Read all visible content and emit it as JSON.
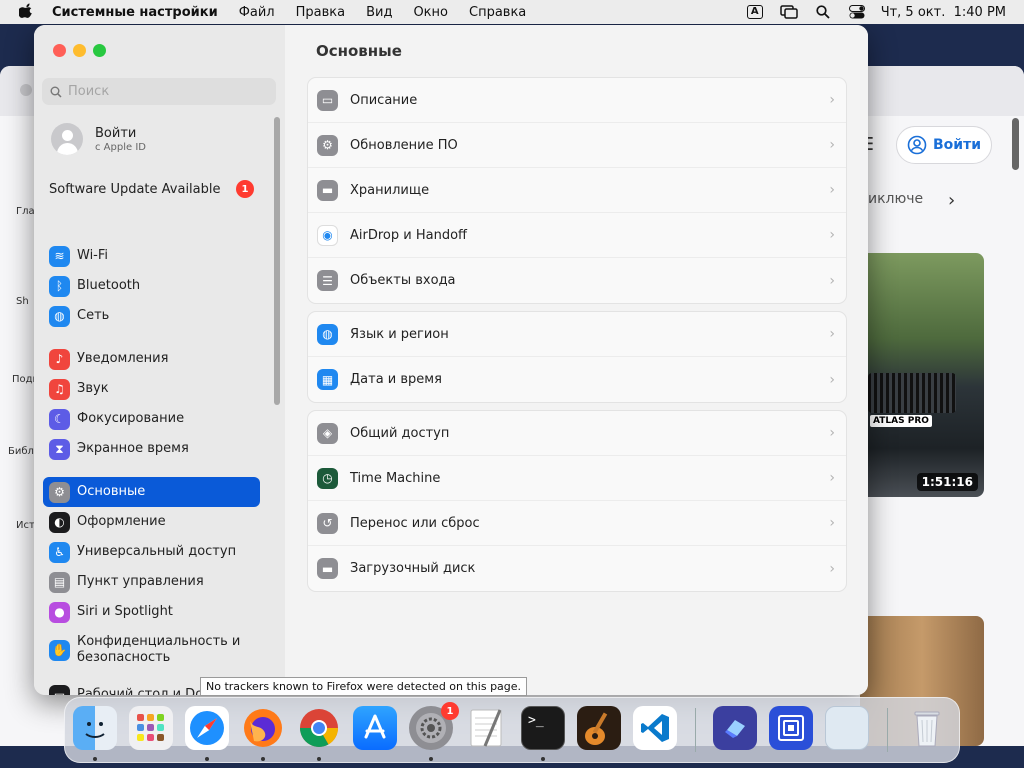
{
  "menubar": {
    "app_name": "Системные настройки",
    "items": [
      "Файл",
      "Правка",
      "Вид",
      "Окно",
      "Справка"
    ],
    "input_indicator": "A",
    "clock": "Чт, 5 окт.  1:40 PM"
  },
  "background_browser": {
    "login_label": "Войти",
    "chip_label": "иключе",
    "video_duration": "1:51:16",
    "video_badge": "ATLAS PRO",
    "left_labels": [
      "Гла",
      "Sh",
      "Подп",
      "Библ",
      "Ист"
    ]
  },
  "settings": {
    "search_placeholder": "Поиск",
    "account": {
      "name": "Войти",
      "subtitle": "с Apple ID"
    },
    "software_update": {
      "label": "Software Update Available",
      "badge": "1"
    },
    "sidebar": [
      {
        "label": "Wi-Fi",
        "icon": "wifi-icon",
        "color": "#1f88f0"
      },
      {
        "label": "Bluetooth",
        "icon": "bluetooth-icon",
        "color": "#1f88f0"
      },
      {
        "label": "Сеть",
        "icon": "globe-icon",
        "color": "#1f88f0"
      },
      {
        "label": "Уведомления",
        "icon": "bell-icon",
        "color": "#f0453d"
      },
      {
        "label": "Звук",
        "icon": "speaker-icon",
        "color": "#f0453d"
      },
      {
        "label": "Фокусирование",
        "icon": "moon-icon",
        "color": "#5d5ce6"
      },
      {
        "label": "Экранное время",
        "icon": "hourglass-icon",
        "color": "#5d5ce6"
      },
      {
        "label": "Основные",
        "icon": "gear-icon",
        "color": "#8e8e93"
      },
      {
        "label": "Оформление",
        "icon": "appearance-icon",
        "color": "#1c1c1e"
      },
      {
        "label": "Универсальный доступ",
        "icon": "accessibility-icon",
        "color": "#1f88f0"
      },
      {
        "label": "Пункт управления",
        "icon": "control-center-icon",
        "color": "#8e8e93"
      },
      {
        "label": "Siri и Spotlight",
        "icon": "siri-icon",
        "color": "#b84de0"
      },
      {
        "label": "Конфиденциальность и безопасность",
        "icon": "hand-icon",
        "color": "#1f88f0"
      },
      {
        "label": "Рабочий стол и Dock",
        "icon": "dock-icon",
        "color": "#1c1c1e"
      }
    ],
    "main_title": "Основные",
    "groups": [
      [
        {
          "label": "Описание",
          "icon": "display-icon",
          "color": "#8e8e93"
        },
        {
          "label": "Обновление ПО",
          "icon": "gear-badge-icon",
          "color": "#8e8e93"
        },
        {
          "label": "Хранилище",
          "icon": "storage-icon",
          "color": "#8e8e93"
        },
        {
          "label": "AirDrop и Handoff",
          "icon": "airdrop-icon",
          "color": "#ffffff"
        },
        {
          "label": "Объекты входа",
          "icon": "list-icon",
          "color": "#8e8e93"
        }
      ],
      [
        {
          "label": "Язык и регион",
          "icon": "globe-icon",
          "color": "#1f88f0"
        },
        {
          "label": "Дата и время",
          "icon": "calendar-icon",
          "color": "#1f88f0"
        }
      ],
      [
        {
          "label": "Общий доступ",
          "icon": "sharing-icon",
          "color": "#8e8e93"
        },
        {
          "label": "Time Machine",
          "icon": "time-machine-icon",
          "color": "#1c5a3a"
        },
        {
          "label": "Перенос или сброс",
          "icon": "reset-icon",
          "color": "#8e8e93"
        },
        {
          "label": "Загрузочный диск",
          "icon": "disk-icon",
          "color": "#8e8e93"
        }
      ]
    ]
  },
  "tooltip": "No trackers known to Firefox were detected on this page.",
  "dock": {
    "apps": [
      "finder",
      "launchpad",
      "safari",
      "firefox",
      "chrome",
      "app-store",
      "system-settings",
      "textedit",
      "terminal",
      "garageband",
      "vscode"
    ],
    "settings_badge": "1",
    "extra": [
      "shortcuts",
      "screens",
      "preview",
      "trash"
    ]
  }
}
